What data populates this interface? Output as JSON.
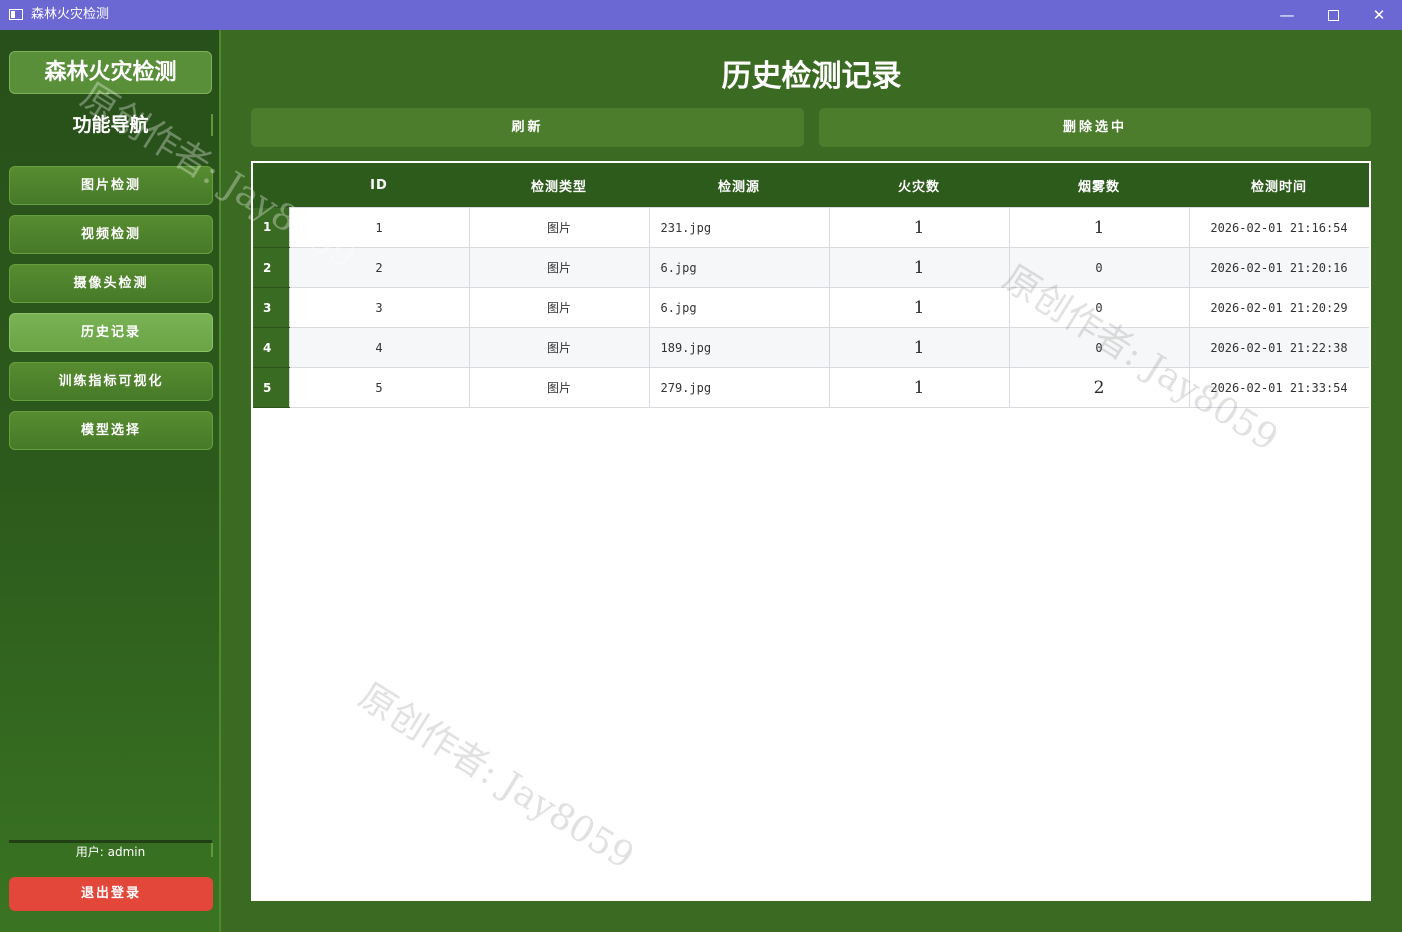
{
  "window": {
    "title": "森林火灾检测",
    "minimize": "—",
    "close": "✕"
  },
  "sidebar": {
    "app_title": "森林火灾检测",
    "nav_title": "功能导航",
    "items": [
      {
        "label": "图片检测",
        "active": false
      },
      {
        "label": "视频检测",
        "active": false
      },
      {
        "label": "摄像头检测",
        "active": false
      },
      {
        "label": "历史记录",
        "active": true
      },
      {
        "label": "训练指标可视化",
        "active": false
      },
      {
        "label": "模型选择",
        "active": false
      }
    ],
    "user_label": "用户: admin",
    "logout_label": "退出登录"
  },
  "main": {
    "page_title": "历史检测记录",
    "refresh_label": "刷新",
    "delete_label": "删除选中",
    "table": {
      "columns": [
        "ID",
        "检测类型",
        "检测源",
        "火灾数",
        "烟雾数",
        "检测时间"
      ],
      "rows": [
        {
          "row_num": "1",
          "id": "1",
          "type": "图片",
          "source": "231.jpg",
          "fire": "1",
          "smoke": "1",
          "time": "2026-02-01 21:16:54"
        },
        {
          "row_num": "2",
          "id": "2",
          "type": "图片",
          "source": "6.jpg",
          "fire": "1",
          "smoke": "0",
          "time": "2026-02-01 21:20:16"
        },
        {
          "row_num": "3",
          "id": "3",
          "type": "图片",
          "source": "6.jpg",
          "fire": "1",
          "smoke": "0",
          "time": "2026-02-01 21:20:29"
        },
        {
          "row_num": "4",
          "id": "4",
          "type": "图片",
          "source": "189.jpg",
          "fire": "1",
          "smoke": "0",
          "time": "2026-02-01 21:22:38"
        },
        {
          "row_num": "5",
          "id": "5",
          "type": "图片",
          "source": "279.jpg",
          "fire": "1",
          "smoke": "2",
          "time": "2026-02-01 21:33:54"
        }
      ]
    }
  },
  "watermark": "原创作者: Jay8059",
  "colors": {
    "titlebar": "#6b68d4",
    "sidebar": "#2c5a1c",
    "main_bg": "#3b6a22",
    "button": "#4c7d2c",
    "active_nav": "#6aa445",
    "logout": "#e2473a"
  }
}
